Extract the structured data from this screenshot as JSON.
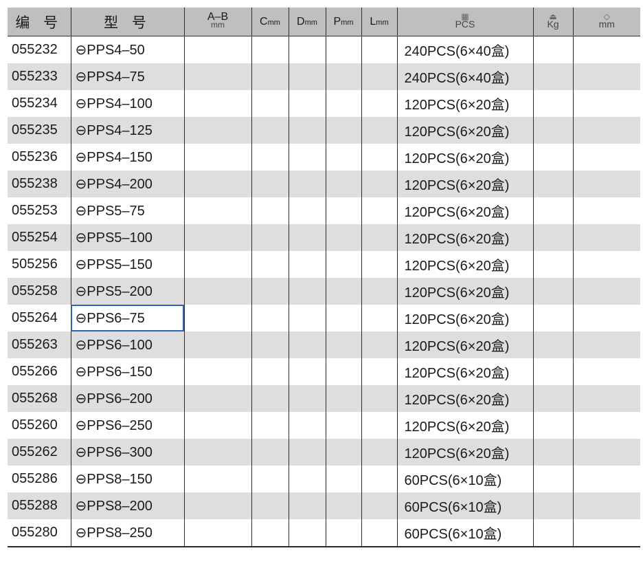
{
  "header": {
    "code": "编 号",
    "model": "型 号",
    "ab": "A–B",
    "ab_unit": "mm",
    "c": "C",
    "d": "D",
    "p": "P",
    "l": "L",
    "unit": "mm",
    "pcs": "PCS",
    "kg": "Kg",
    "size_unit": "mm",
    "icon_carton": "carton-icon",
    "icon_weight": "weight-icon",
    "icon_box": "box-icon"
  },
  "rows": [
    {
      "code": "055232",
      "model": "⊖PPS4–50",
      "pack": "240PCS(6×40盒)"
    },
    {
      "code": "055233",
      "model": "⊖PPS4–75",
      "pack": "240PCS(6×40盒)"
    },
    {
      "code": "055234",
      "model": "⊖PPS4–100",
      "pack": "120PCS(6×20盒)"
    },
    {
      "code": "055235",
      "model": "⊖PPS4–125",
      "pack": "120PCS(6×20盒)"
    },
    {
      "code": "055236",
      "model": "⊖PPS4–150",
      "pack": "120PCS(6×20盒)"
    },
    {
      "code": "055238",
      "model": "⊖PPS4–200",
      "pack": "120PCS(6×20盒)"
    },
    {
      "code": "055253",
      "model": "⊖PPS5–75",
      "pack": "120PCS(6×20盒)"
    },
    {
      "code": "055254",
      "model": "⊖PPS5–100",
      "pack": "120PCS(6×20盒)"
    },
    {
      "code": "505256",
      "model": "⊖PPS5–150",
      "pack": "120PCS(6×20盒)"
    },
    {
      "code": "055258",
      "model": "⊖PPS5–200",
      "pack": "120PCS(6×20盒)"
    },
    {
      "code": "055264",
      "model": "⊖PPS6–75",
      "pack": "120PCS(6×20盒)"
    },
    {
      "code": "055263",
      "model": "⊖PPS6–100",
      "pack": "120PCS(6×20盒)"
    },
    {
      "code": "055266",
      "model": "⊖PPS6–150",
      "pack": "120PCS(6×20盒)"
    },
    {
      "code": "055268",
      "model": "⊖PPS6–200",
      "pack": "120PCS(6×20盒)"
    },
    {
      "code": "055260",
      "model": "⊖PPS6–250",
      "pack": "120PCS(6×20盒)"
    },
    {
      "code": "055262",
      "model": "⊖PPS6–300",
      "pack": "120PCS(6×20盒)"
    },
    {
      "code": "055286",
      "model": "⊖PPS8–150",
      "pack": "60PCS(6×10盒)"
    },
    {
      "code": "055288",
      "model": "⊖PPS8–200",
      "pack": "60PCS(6×10盒)"
    },
    {
      "code": "055280",
      "model": "⊖PPS8–250",
      "pack": "60PCS(6×10盒)"
    }
  ],
  "colors": {
    "header_bg": "#bfbfbf",
    "stripe_bg": "#dedede",
    "selection": "#2e63b8"
  }
}
